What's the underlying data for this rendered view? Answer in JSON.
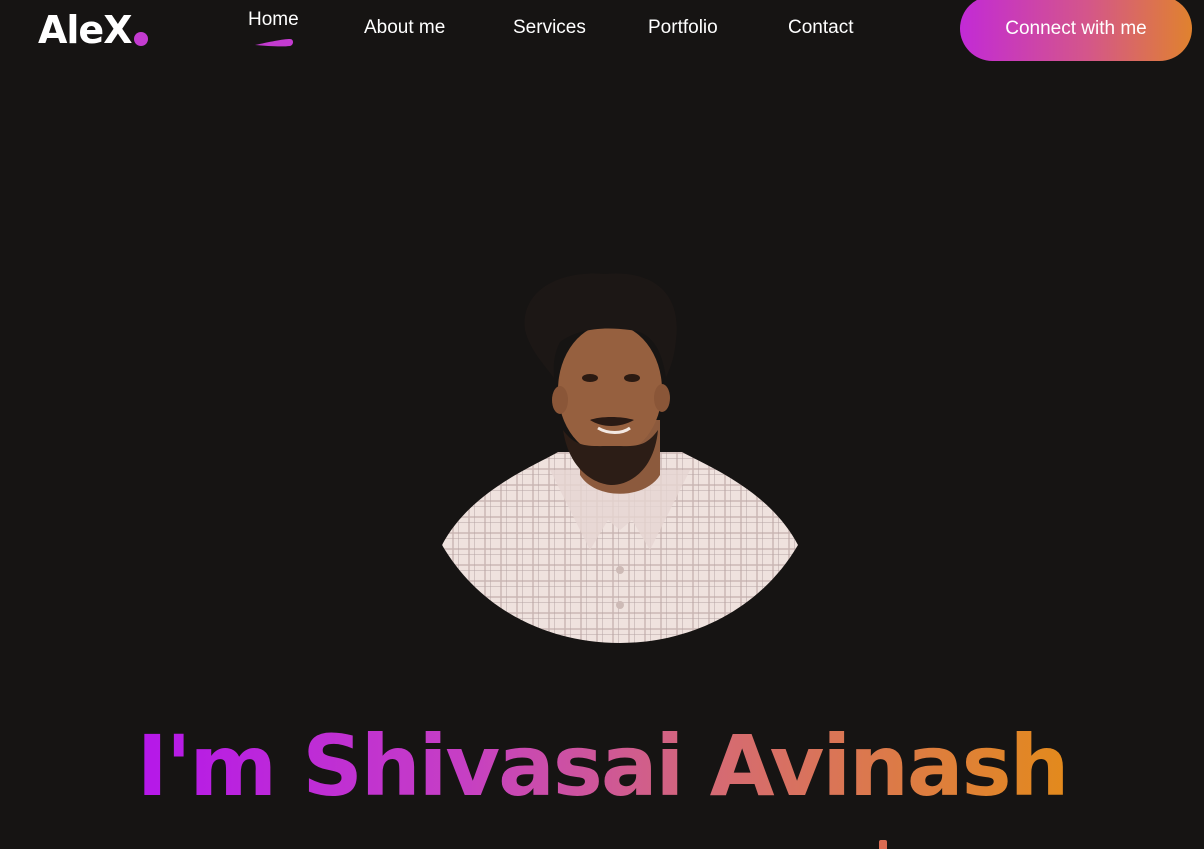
{
  "logo": {
    "text": "AleX"
  },
  "nav": {
    "items": [
      {
        "label": "Home",
        "active": true
      },
      {
        "label": "About me"
      },
      {
        "label": "Services"
      },
      {
        "label": "Portfolio"
      },
      {
        "label": "Contact"
      }
    ]
  },
  "cta": {
    "label": "Connect with me"
  },
  "hero": {
    "headline": "I'm Shivasai Avinash"
  },
  "colors": {
    "background": "#161413",
    "accent_purple": "#b517ea",
    "accent_pink": "#c33bd0",
    "accent_orange": "#e38a1c"
  }
}
